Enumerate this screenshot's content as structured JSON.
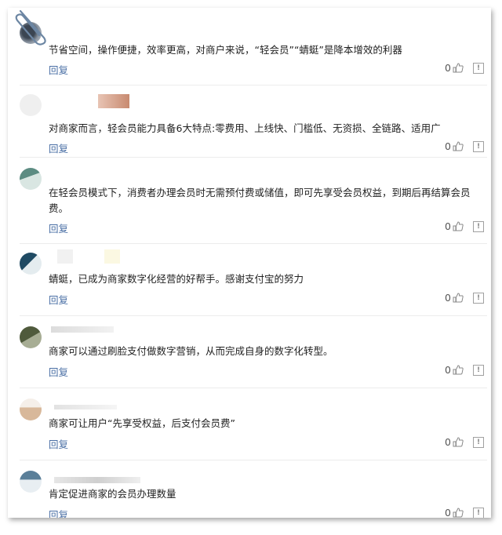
{
  "comments": [
    {
      "text": "节省空间，操作便捷，效率更高，对商户来说，“轻会员”“蜻蜓”是降本增效的利器",
      "reply": "回复",
      "likes": "0"
    },
    {
      "text": "对商家而言，轻会员能力具备6大特点:零费用、上线快、门槛低、无资损、全链路、适用广",
      "reply": "回复",
      "likes": "0"
    },
    {
      "text": "在轻会员模式下，消费者办理会员时无需预付费或储值，即可先享受会员权益，到期后再结算会员费。",
      "reply": "回复",
      "likes": "0"
    },
    {
      "text": "蜻蜓，已成为商家数字化经营的好帮手。感谢支付宝的努力",
      "reply": "回复",
      "likes": "0"
    },
    {
      "text": "商家可以通过刷脸支付做数字营销，从而完成自身的数字化转型。",
      "reply": "回复",
      "likes": "0"
    },
    {
      "text": "商家可让用户“先享受权益，后支付会员费”",
      "reply": "回复",
      "likes": "0"
    },
    {
      "text": "肯定促进商家的会员办理数量",
      "reply": "回复",
      "likes": "0"
    }
  ],
  "icons": {
    "like": "thumbs-up-icon",
    "report": "report-icon",
    "clip": "paperclip-icon"
  },
  "colors": {
    "reply_link": "#4a6fa5",
    "border": "#ececec"
  }
}
